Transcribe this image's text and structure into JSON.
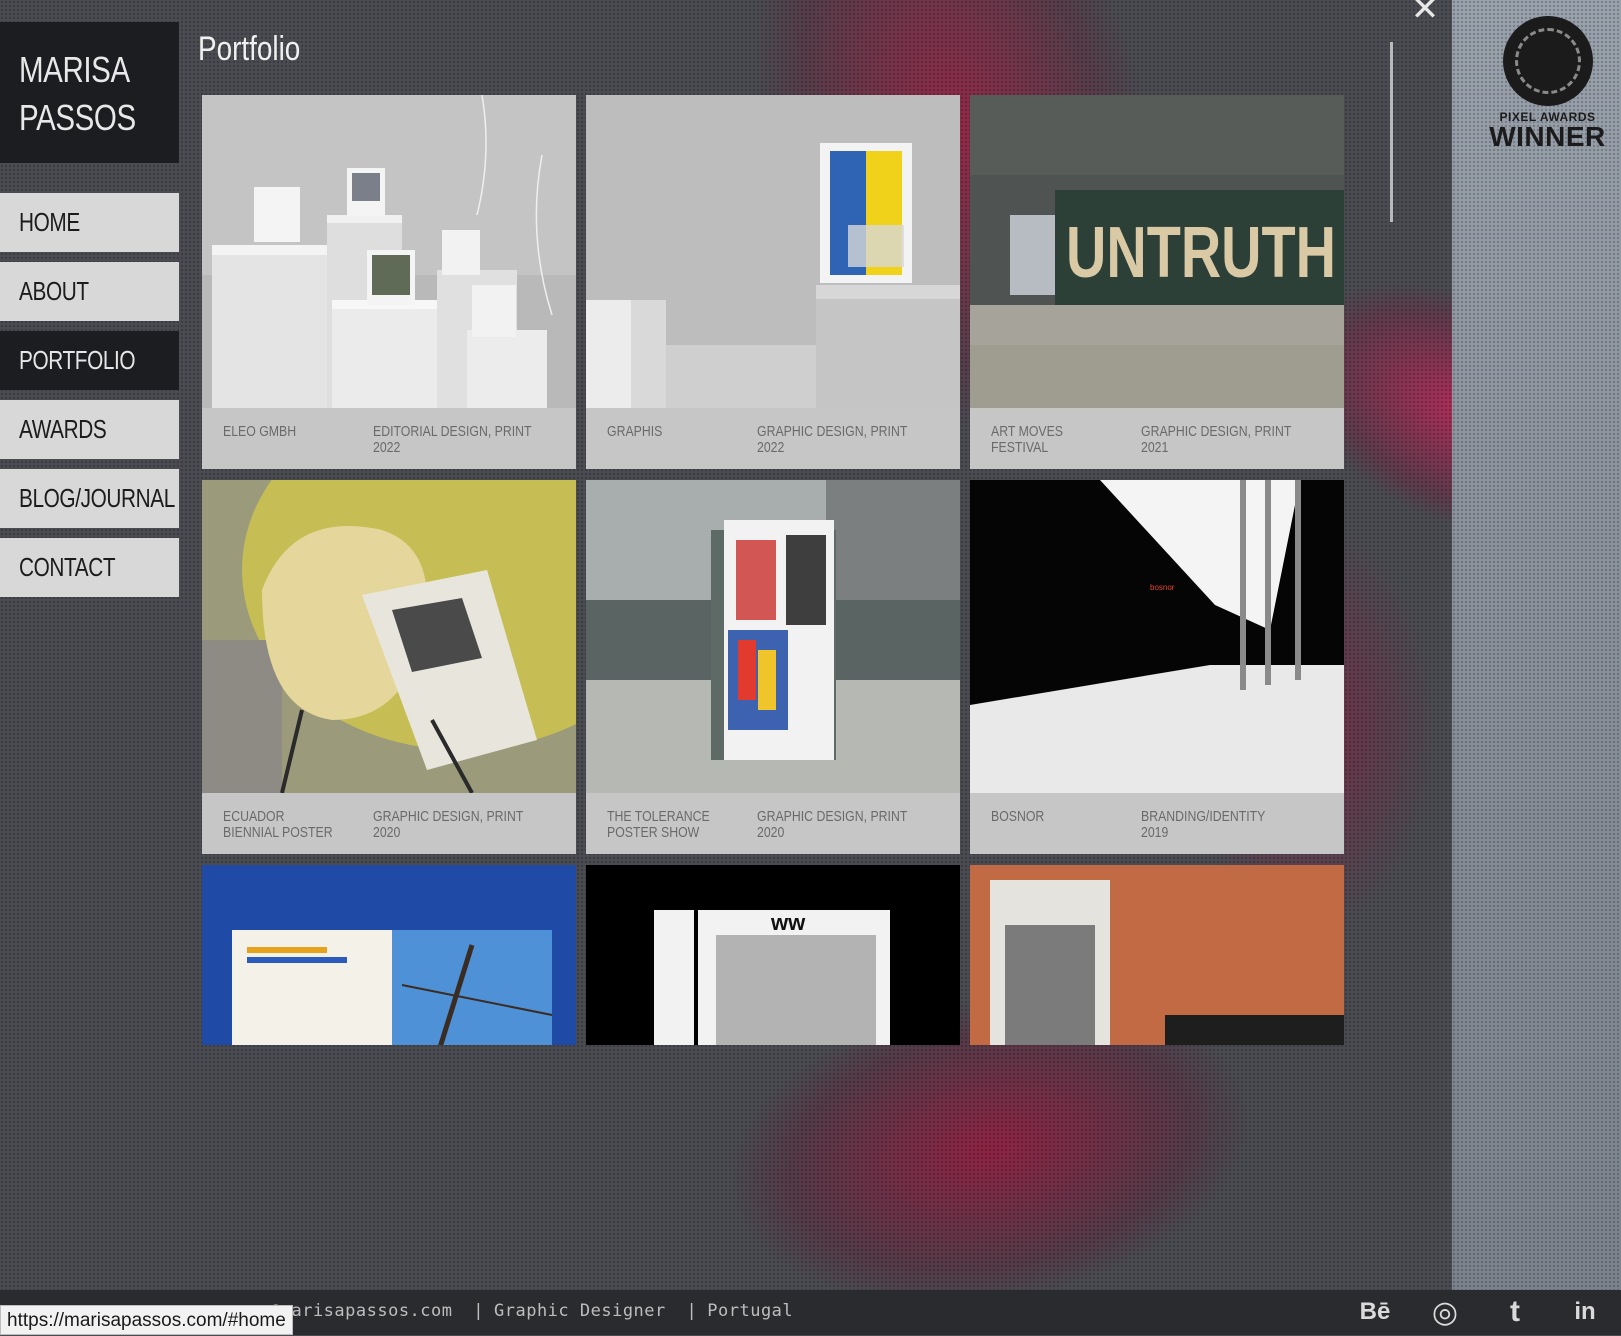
{
  "site": {
    "logo_line1": "MARISA",
    "logo_line2": "PASSOS"
  },
  "nav": {
    "items": [
      {
        "label": "HOME",
        "active": false
      },
      {
        "label": "ABOUT",
        "active": false
      },
      {
        "label": "PORTFOLIO",
        "active": true
      },
      {
        "label": "AWARDS",
        "active": false
      },
      {
        "label": "BLOG/JOURNAL",
        "active": false
      },
      {
        "label": "CONTACT",
        "active": false
      }
    ]
  },
  "main": {
    "title": "Portfolio",
    "close_icon": "close-icon"
  },
  "portfolio": [
    {
      "name": "ELEO GMBH",
      "category": "EDITORIAL DESIGN, PRINT",
      "year": "2022"
    },
    {
      "name": "GRAPHIS",
      "category": "GRAPHIC DESIGN, PRINT",
      "year": "2022"
    },
    {
      "name": "ART MOVES FESTIVAL",
      "category": "GRAPHIC DESIGN, PRINT",
      "year": "2021",
      "thumb_text": "UNTRUTH"
    },
    {
      "name": "ECUADOR BIENNIAL POSTER",
      "category": "GRAPHIC DESIGN, PRINT",
      "year": "2020"
    },
    {
      "name": "THE TOLERANCE POSTER SHOW",
      "category": "GRAPHIC DESIGN, PRINT",
      "year": "2020"
    },
    {
      "name": "BOSNOR",
      "category": "BRANDING/IDENTITY",
      "year": "2019"
    },
    {
      "name": "",
      "category": "",
      "year": ""
    },
    {
      "name": "",
      "category": "",
      "year": ""
    },
    {
      "name": "",
      "category": "",
      "year": ""
    }
  ],
  "badge": {
    "line1": "PIXEL AWARDS",
    "line2": "WINNER"
  },
  "footer": {
    "email": "@marisapassos.com",
    "role": "Graphic Designer",
    "location": "Portugal",
    "social": [
      {
        "icon": "behance-icon",
        "glyph": "Bē"
      },
      {
        "icon": "instagram-icon",
        "glyph": "◎"
      },
      {
        "icon": "tumblr-icon",
        "glyph": "t"
      },
      {
        "icon": "linkedin-icon",
        "glyph": "in"
      }
    ]
  },
  "status_bar": {
    "url": "https://marisapassos.com/#home"
  }
}
